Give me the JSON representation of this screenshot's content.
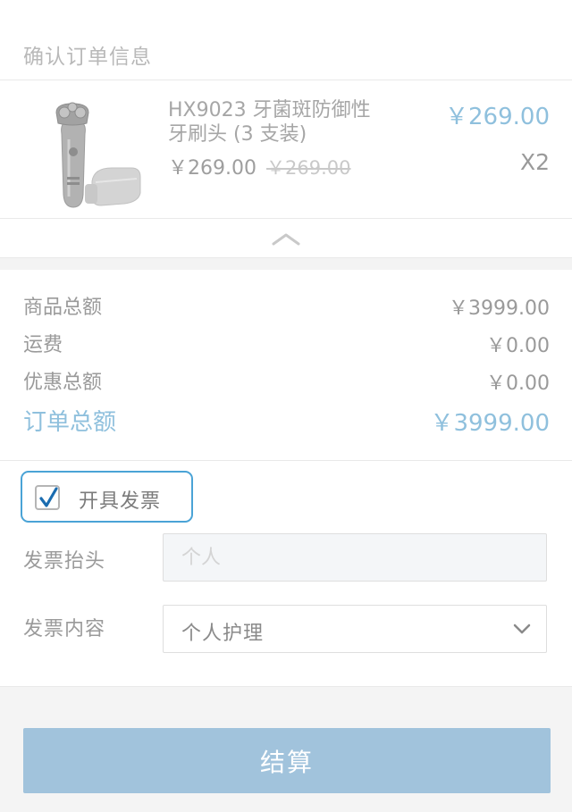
{
  "order": {
    "section_title": "确认订单信息"
  },
  "product": {
    "image_icon": "electric-shaver-icon",
    "name": "HX9023 牙菌斑防御性牙刷头 (3 支装)",
    "price": "￥269.00",
    "original_price": "￥269.00",
    "total": "￥269.00",
    "quantity": "X2"
  },
  "collapse_icon": "chevron-up-icon",
  "summary": {
    "items": [
      {
        "label": "商品总额",
        "value": "￥3999.00"
      },
      {
        "label": "运费",
        "value": "￥0.00"
      },
      {
        "label": "优惠总额",
        "value": "￥0.00"
      }
    ],
    "total_label": "订单总额",
    "total_value": "￥3999.00"
  },
  "invoice": {
    "toggle_label": "开具发票",
    "checked": true,
    "title_label": "发票抬头",
    "title_placeholder": "个人",
    "content_label": "发票内容",
    "content_value": "个人护理",
    "content_icon": "chevron-down-icon"
  },
  "checkout": {
    "label": "结算"
  },
  "colors": {
    "accent": "#8fc0dd",
    "button": "#a1c3dc",
    "focus_border": "#4aa3d6",
    "checkmark": "#1a6cb0"
  }
}
